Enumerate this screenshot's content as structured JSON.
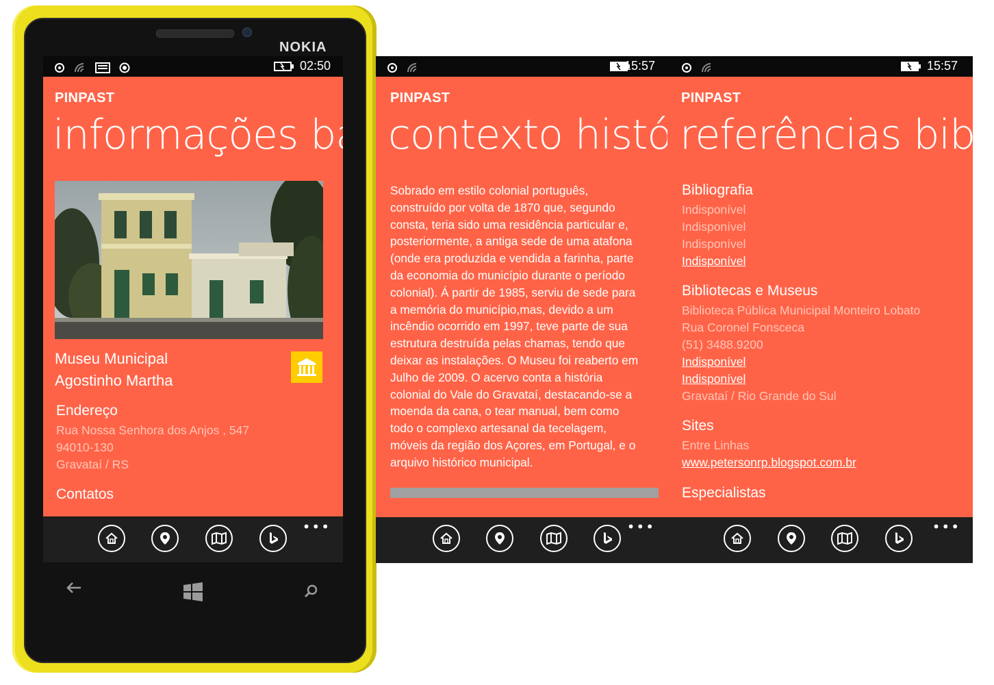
{
  "phone": {
    "brand": "NOKIA"
  },
  "screen1": {
    "status_time": "02:50",
    "app_name": "PINPAST",
    "pivot_title": "informações bá",
    "place_name_line1": "Museu Municipal",
    "place_name_line2": "Agostinho Martha",
    "address_heading": "Endereço",
    "address_line1": "Rua Nossa Senhora dos Anjos , 547",
    "address_line2": "94010-130",
    "address_line3": "Gravataí / RS",
    "contacts_heading": "Contatos"
  },
  "screen2": {
    "status_time": "15:57",
    "app_name": "PINPAST",
    "pivot_title": "contexto histó",
    "body_lines": [
      "Sobrado em estilo colonial português,",
      "construído por volta de 1870 que, segundo",
      "consta, teria sido uma residência particular e,",
      "posteriormente, a antiga sede de uma atafona",
      "(onde era produzida e vendida a farinha, parte",
      "da economia do município durante o período",
      "colonial). Á partir de 1985, serviu de sede para",
      "a memória do município,mas, devido a um",
      "incêndio ocorrido em 1997, teve parte de sua",
      "estrutura destruída pelas chamas, tendo que",
      "deixar as instalações. O Museu foi reaberto em",
      "Julho de 2009. O acervo conta a história",
      "colonial do Vale do Gravataí, destacando-se a",
      "moenda da cana, o tear manual, bem como",
      "todo o complexo artesanal da tecelagem,",
      "móveis da região dos Açores, em Portugal, e o",
      "arquivo histórico municipal."
    ]
  },
  "screen3": {
    "status_time": "15:57",
    "app_name": "PINPAST",
    "pivot_title": "referências bibl",
    "bibliografia_heading": "Bibliografia",
    "bibliografia_items": [
      "Indisponível",
      "Indisponível",
      "Indisponível"
    ],
    "bibliografia_link": "Indisponível",
    "bibliotecas_heading": "Bibliotecas e Museus",
    "bibliotecas_items": [
      "Biblioteca Pública Municipal Monteiro Lobato",
      "Rua Coronel Fonsceca",
      "(51) 3488.9200"
    ],
    "bibliotecas_links": [
      "Indisponível",
      "Indisponível"
    ],
    "bibliotecas_city": "Gravataí / Rio Grande do Sul",
    "sites_heading": "Sites",
    "sites_item": "Entre Linhas",
    "sites_link": "www.petersonrp.blogspot.com.br",
    "especialistas_heading": "Especialistas"
  },
  "appbar_icons": [
    "home-icon",
    "location-pin-icon",
    "map-icon",
    "bing-icon"
  ],
  "appbar_more": "•••",
  "colors": {
    "accent": "#ff6347",
    "phone_shell": "#ecdf1e",
    "museum_tile": "#ffcc00"
  }
}
